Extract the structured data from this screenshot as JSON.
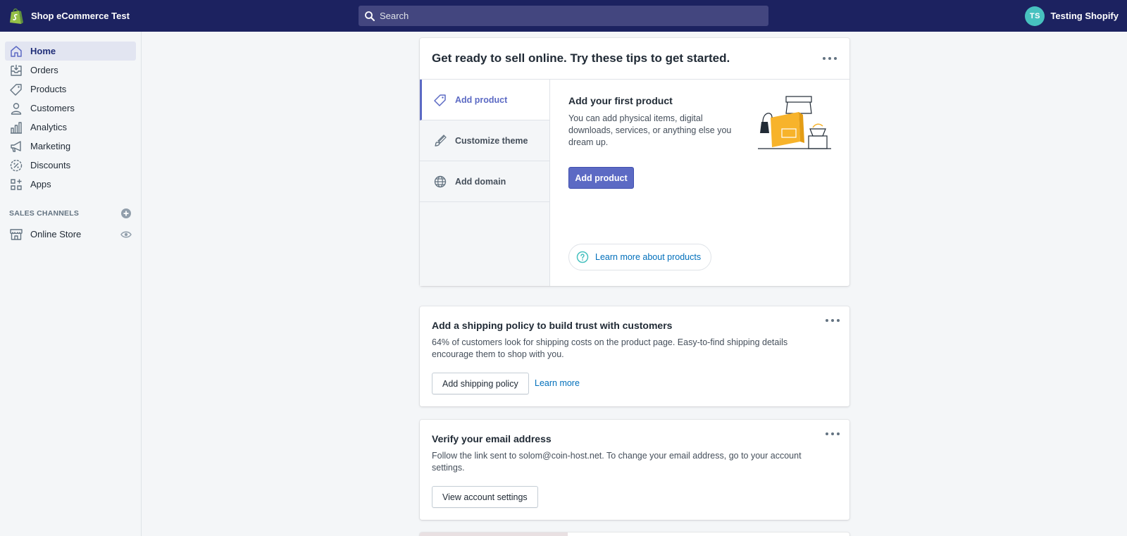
{
  "topbar": {
    "store_name": "Shop eCommerce Test",
    "search_placeholder": "Search",
    "user_initials": "TS",
    "user_name": "Testing Shopify"
  },
  "sidebar": {
    "items": [
      {
        "label": "Home",
        "icon": "home-icon",
        "active": true
      },
      {
        "label": "Orders",
        "icon": "orders-icon"
      },
      {
        "label": "Products",
        "icon": "tag-icon"
      },
      {
        "label": "Customers",
        "icon": "person-icon"
      },
      {
        "label": "Analytics",
        "icon": "bar-chart-icon"
      },
      {
        "label": "Marketing",
        "icon": "megaphone-icon"
      },
      {
        "label": "Discounts",
        "icon": "discount-icon"
      },
      {
        "label": "Apps",
        "icon": "apps-icon"
      }
    ],
    "sales_channels_title": "SALES CHANNELS",
    "online_store_label": "Online Store"
  },
  "tips_card": {
    "title": "Get ready to sell online. Try these tips to get started.",
    "tabs": [
      {
        "label": "Add product",
        "icon": "tag-icon",
        "active": true
      },
      {
        "label": "Customize theme",
        "icon": "paintbrush-icon"
      },
      {
        "label": "Add domain",
        "icon": "globe-icon"
      }
    ],
    "panel": {
      "title": "Add your first product",
      "description": "You can add physical items, digital downloads, services, or anything else you dream up.",
      "button_label": "Add product",
      "learn_more": "Learn more about products"
    }
  },
  "shipping_card": {
    "title": "Add a shipping policy to build trust with customers",
    "description": "64% of customers look for shipping costs on the product page. Easy-to-find shipping details encourage them to shop with you.",
    "button_label": "Add shipping policy",
    "link_label": "Learn more"
  },
  "email_card": {
    "title": "Verify your email address",
    "description": "Follow the link sent to solom@coin-host.net. To change your email address, go to your account settings.",
    "button_label": "View account settings"
  },
  "colors": {
    "topbar": "#1c2260",
    "accent": "#5c6ac4",
    "link": "#006fbb",
    "avatar": "#47c1bf"
  }
}
